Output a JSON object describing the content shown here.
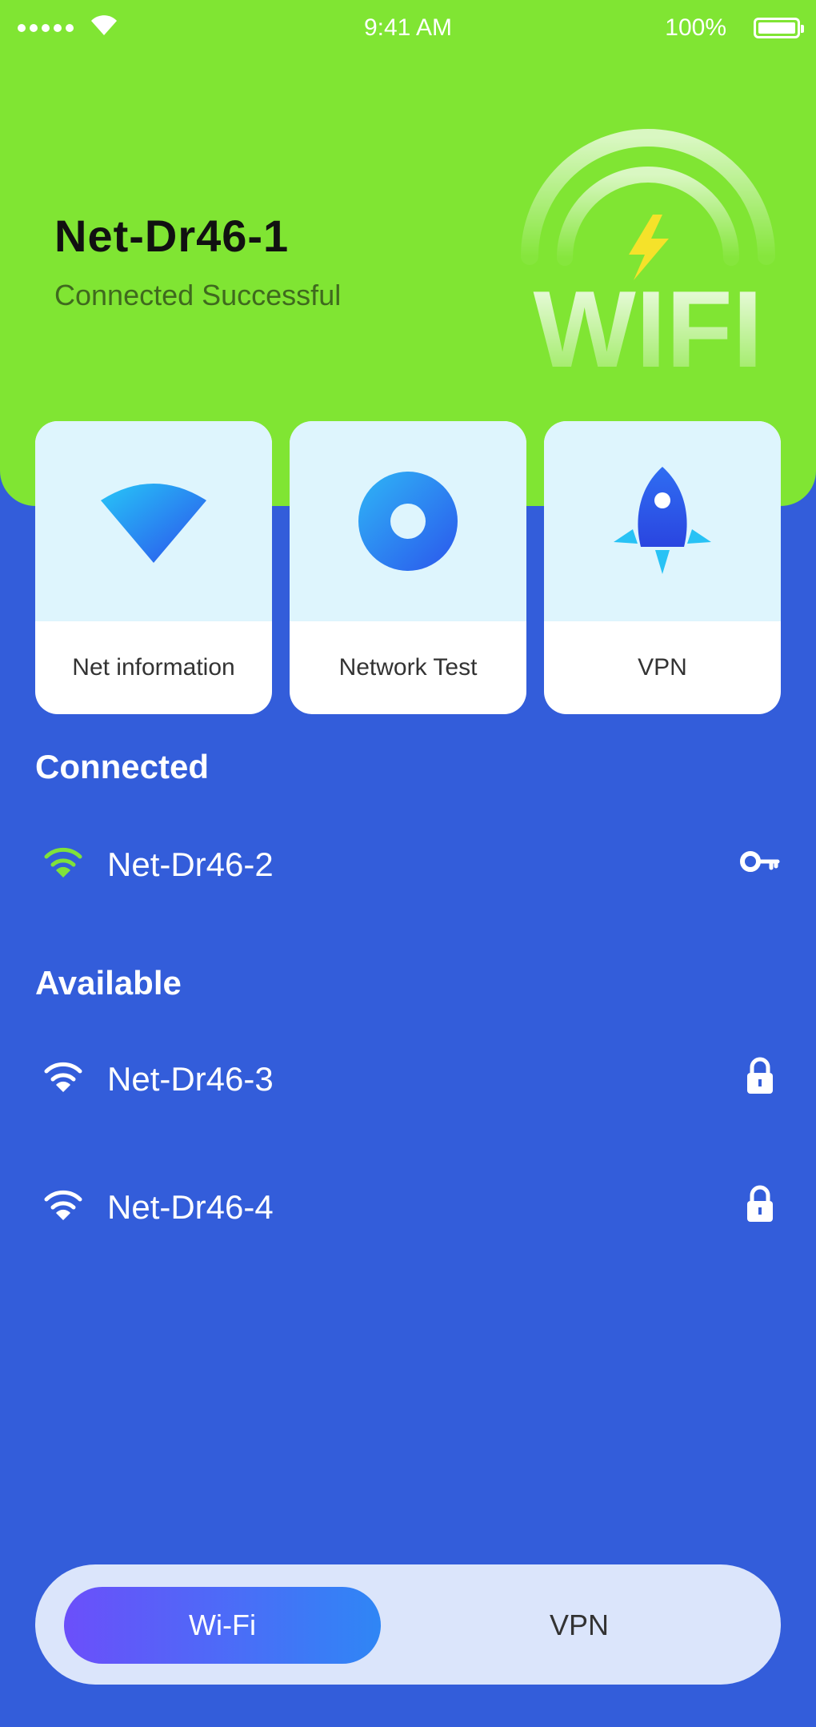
{
  "status_bar": {
    "time": "9:41 AM",
    "battery": "100%"
  },
  "header": {
    "network_name": "Net-Dr46-1",
    "status": "Connected Successful",
    "logo_text": "WIFI"
  },
  "cards": [
    {
      "label": "Net information",
      "icon": "wifi-signal-icon"
    },
    {
      "label": "Network Test",
      "icon": "network-test-icon"
    },
    {
      "label": "VPN",
      "icon": "rocket-icon"
    }
  ],
  "connected": {
    "title": "Connected",
    "networks": [
      {
        "name": "Net-Dr46-2",
        "icon": "key-icon"
      }
    ]
  },
  "available": {
    "title": "Available",
    "networks": [
      {
        "name": "Net-Dr46-3",
        "icon": "lock-icon"
      },
      {
        "name": "Net-Dr46-4",
        "icon": "lock-icon"
      }
    ]
  },
  "tabs": {
    "wifi": "Wi-Fi",
    "vpn": "VPN"
  },
  "colors": {
    "hero_green": "#80e533",
    "background_blue": "#335dda",
    "card_top": "#def5fd",
    "tab_bg": "#dbe5fb",
    "accent_purple": "#6b4ffa",
    "accent_blue": "#2f86f5"
  }
}
